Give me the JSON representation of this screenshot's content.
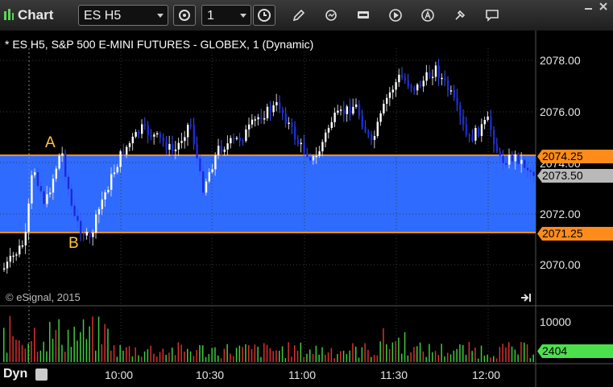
{
  "toolbar": {
    "title": "Chart",
    "symbol": "ES H5",
    "interval": "1",
    "icons": [
      "chart-settings-icon",
      "clock-icon",
      "pencil-icon",
      "refresh-icon",
      "data-icon",
      "play-icon",
      "alert-icon",
      "tools-icon",
      "comment-icon"
    ]
  },
  "chart": {
    "header": "* ES H5, S&P 500 E-MINI FUTURES - GLOBEX, 1 (Dynamic)",
    "copyright": "© eSignal, 2015",
    "price_labels": [
      "2078.00",
      "2076.00",
      "2074.00",
      "2072.00",
      "2070.00"
    ],
    "upper_level": "2074.25",
    "lower_level": "2071.25",
    "last_price": "2073.50",
    "annotation_a": "A",
    "annotation_b": "B",
    "volume_scale": "10000",
    "last_volume": "2404",
    "time_labels": [
      "10:00",
      "10:30",
      "11:00",
      "11:30",
      "12:00"
    ],
    "footer_label": "Dyn",
    "colors": {
      "band": "#2f6bff",
      "level_line": "#ff8c1a",
      "up": "#ffffff",
      "down": "#1a2cd6",
      "vol_up": "#3ecb3e",
      "vol_down": "#d93030",
      "vol_tag": "#4de04d"
    }
  }
}
